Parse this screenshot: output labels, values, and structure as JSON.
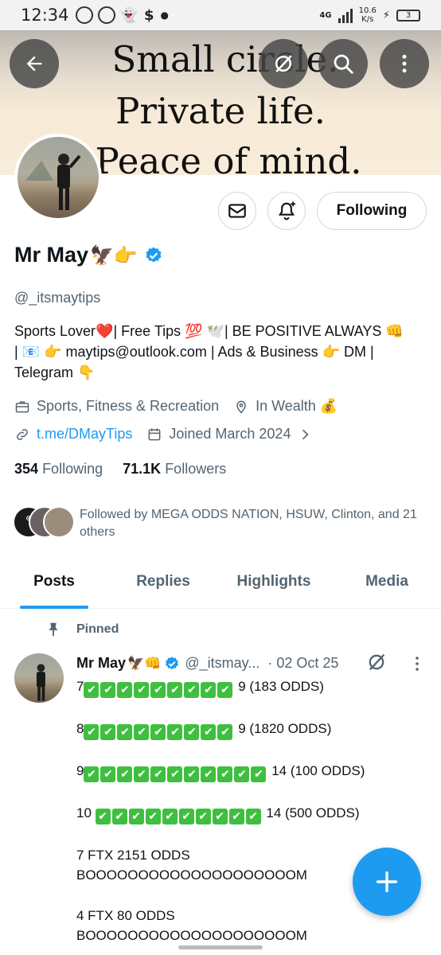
{
  "status_bar": {
    "time": "12:34",
    "speed_value": "10.6",
    "speed_unit": "K/s",
    "battery": "3",
    "network": "4G"
  },
  "banner": {
    "line1": "Small circle.",
    "line2": "Private life.",
    "line3": "Peace of mind."
  },
  "profile": {
    "name": "Mr May",
    "name_emoji": "🦅👉",
    "handle": "@_itsmaytips",
    "follow_label": "Following",
    "bio_lines": [
      "Sports Lover❤️| Free Tips 💯 🕊️| BE POSITIVE ALWAYS 👊",
      "| 📧 👉 maytips@outlook.com | Ads & Business 👉 DM |",
      "Telegram 👇"
    ],
    "category": "Sports, Fitness & Recreation",
    "location": "In Wealth 💰",
    "website": "t.me/DMayTips",
    "joined": "Joined March 2024",
    "following_count": "354",
    "following_label": "Following",
    "followers_count": "71.1K",
    "followers_label": "Followers",
    "followed_by": "Followed by MEGA ODDS NATION, HSUW, Clinton, and 21 others",
    "followed_by_line2": "21 others"
  },
  "tabs": [
    "Posts",
    "Replies",
    "Highlights",
    "Media"
  ],
  "pinned_label": "Pinned",
  "tweet": {
    "name": "Mr May",
    "name_emoji": "🦅👊",
    "handle": "@_itsmay...",
    "date": "· 02 Oct 25",
    "lines": [
      {
        "prefix": "7",
        "checks": 9,
        "suffix": " 9 (183 ODDS)"
      },
      {
        "prefix": "8",
        "checks": 9,
        "suffix": " 9 (1820 ODDS)"
      },
      {
        "prefix": "9",
        "checks": 11,
        "suffix": " 14 (100 ODDS)"
      },
      {
        "prefix": "10 ",
        "checks": 10,
        "suffix": " 14 (500 ODDS)"
      }
    ],
    "ftx1": "7 FTX 2151 ODDS",
    "boom1": "BOOOOOOOOOOOOOOOOOOOOM",
    "ftx2": "4 FTX 80 ODDS",
    "boom2": "BOOOOOOOOOOOOOOOOOOOOM"
  },
  "colors": {
    "accent": "#1d9bf0",
    "secondary_text": "#536471",
    "check_green": "#3fbf3f"
  }
}
